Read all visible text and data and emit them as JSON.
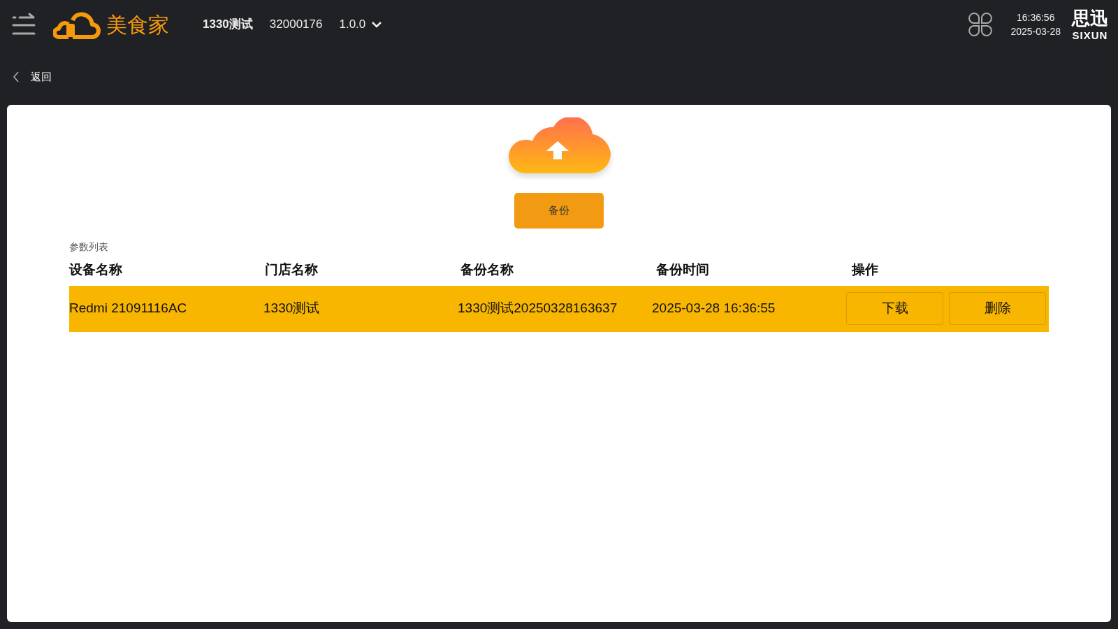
{
  "header": {
    "app_name": "美食家",
    "store": "1330测试",
    "store_code": "32000176",
    "version": "1.0.0",
    "time": "16:36:56",
    "date": "2025-03-28",
    "brand_cn": "思迅",
    "brand_en": "SIXUN"
  },
  "back": {
    "label": "返回"
  },
  "backup_button": "备份",
  "table": {
    "caption": "参数列表",
    "columns": [
      "设备名称",
      "门店名称",
      "备份名称",
      "备份时间",
      "操作"
    ],
    "rows": [
      {
        "selected": true,
        "cells": [
          "Redmi 21091116AC",
          "1330测试",
          "1330测试20250328163637",
          "2025-03-28 16:36:55"
        ],
        "actions": [
          "下载",
          "删除"
        ]
      }
    ]
  }
}
